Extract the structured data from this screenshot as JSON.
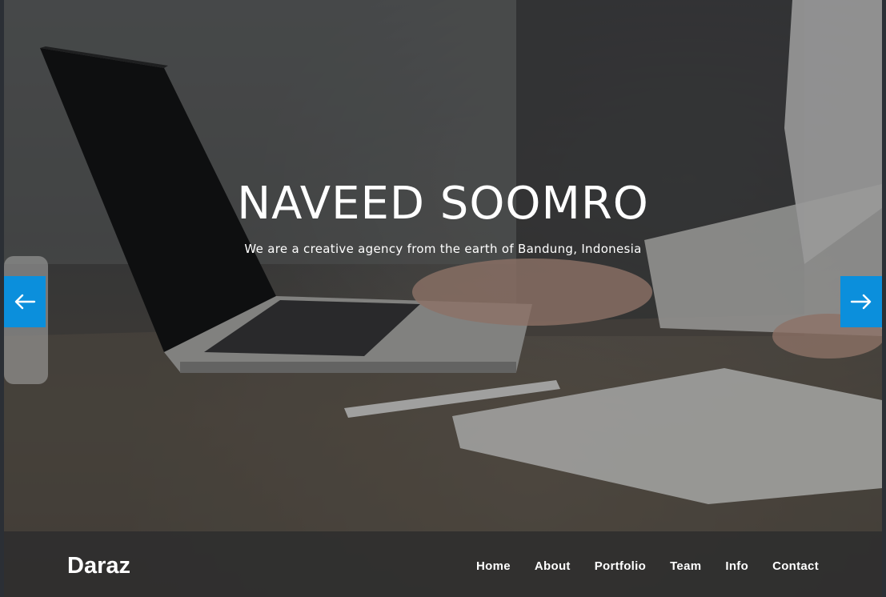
{
  "hero": {
    "title": "NAVEED SOOMRO",
    "subtitle": "We are a creative agency from the earth of Bandung, Indonesia",
    "prev_icon": "arrow-left-icon",
    "next_icon": "arrow-right-icon"
  },
  "navbar": {
    "brand": "Daraz",
    "items": [
      {
        "label": "Home"
      },
      {
        "label": "About"
      },
      {
        "label": "Portfolio"
      },
      {
        "label": "Team"
      },
      {
        "label": "Info"
      },
      {
        "label": "Contact"
      }
    ]
  },
  "colors": {
    "accent": "#0b8fdc",
    "navbar_bg": "#2d2d2d",
    "text": "#ffffff"
  }
}
